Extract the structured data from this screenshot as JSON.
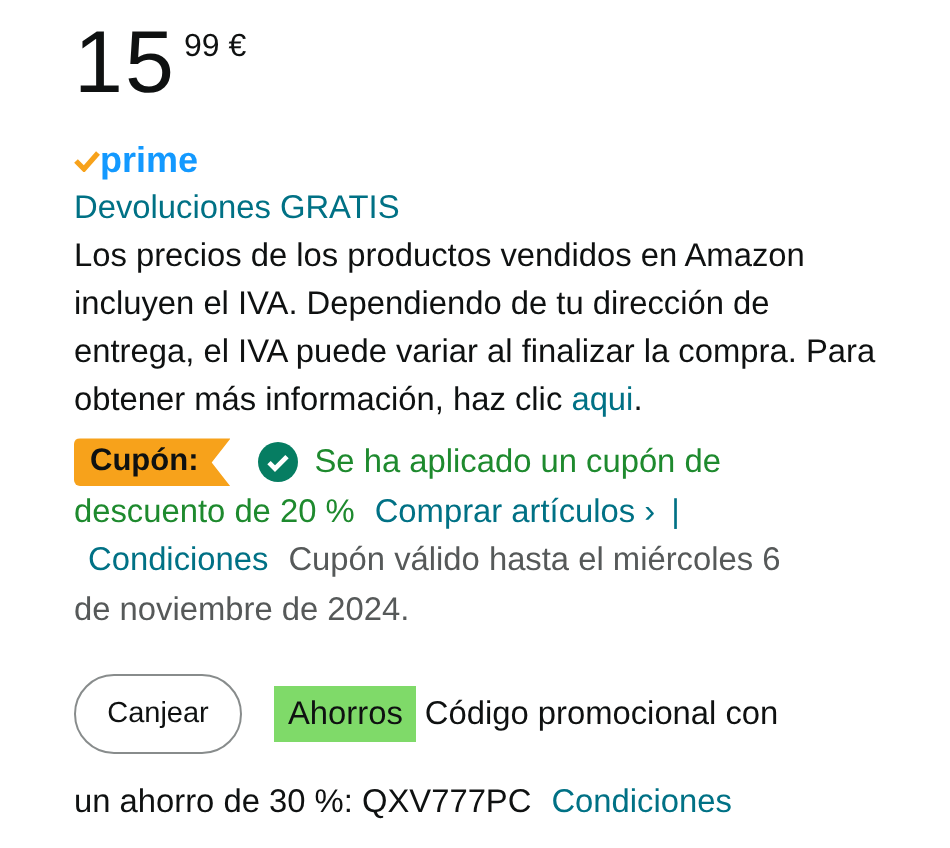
{
  "price": {
    "whole": "15",
    "fraction": "99",
    "currency": "€"
  },
  "prime": {
    "label": "prime"
  },
  "returns_link": "Devoluciones GRATIS",
  "tax_note": {
    "text": "Los precios de los productos vendidos en Amazon incluyen el IVA. Dependiendo de tu dirección de entrega, el IVA puede variar al finalizar la compra. Para obtener más información, haz clic",
    "link": "aqui",
    "end": "."
  },
  "coupon": {
    "badge": "Cupón:",
    "applied": true,
    "message_lines": [
      "Se ha aplicado un cupón de",
      "descuento de 20 %"
    ],
    "shop_link": "Comprar artículos ›",
    "separator": "|",
    "terms_link": "Condiciones",
    "validity_lines": [
      "Cupón válido hasta el miércoles 6",
      "de noviembre de 2024."
    ]
  },
  "promo": {
    "button": "Canjear",
    "badge": "Ahorros",
    "text_lines": [
      "Código promocional con",
      "un ahorro de 30 %: QXV777PC"
    ],
    "terms_link": "Condiciones"
  }
}
